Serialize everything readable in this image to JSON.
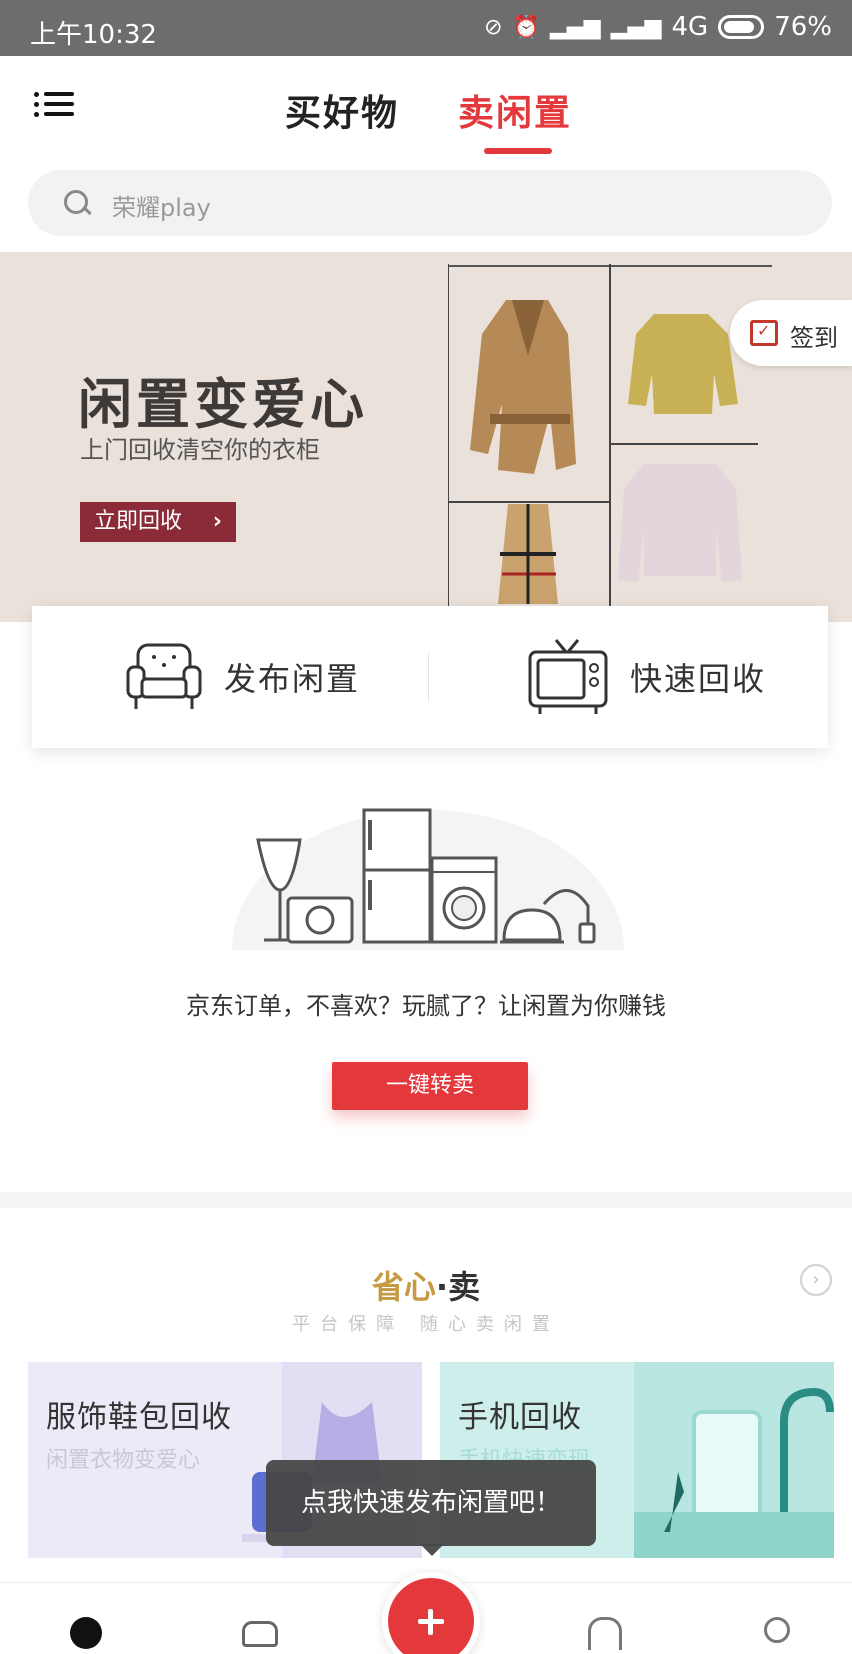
{
  "status_bar": {
    "time": "上午10:32",
    "network": "4G",
    "battery": "76%",
    "icons": [
      "mute-icon",
      "alarm-icon",
      "signal-icon",
      "signal-icon",
      "battery-icon"
    ]
  },
  "header": {
    "tabs": [
      {
        "label": "买好物",
        "active": false
      },
      {
        "label": "卖闲置",
        "active": true
      }
    ],
    "accent_color": "#e4393c"
  },
  "search": {
    "placeholder": "荣耀play"
  },
  "banner": {
    "title": "闲置变爱心",
    "subtitle": "上门回收清空你的衣柜",
    "cta_label": "立即回收",
    "checkin_label": "签到"
  },
  "actions": [
    {
      "label": "发布闲置",
      "icon": "sofa-icon"
    },
    {
      "label": "快速回收",
      "icon": "tv-icon"
    }
  ],
  "promo": {
    "text": "京东订单，不喜欢？玩腻了？让闲置为你赚钱",
    "button_label": "一键转卖"
  },
  "section": {
    "title_highlight": "省心",
    "title_rest": "·卖",
    "subtitle": "平台保障 随心卖闲置"
  },
  "cards": [
    {
      "title": "服饰鞋包回收",
      "subtitle": "闲置衣物变爱心"
    },
    {
      "title": "手机回收",
      "subtitle": "手机快速变现"
    }
  ],
  "toast": {
    "text": "点我快速发布闲置吧！"
  },
  "bottom_nav": {
    "items": [
      "home-icon",
      "cart-icon",
      "publish-icon",
      "message-icon",
      "profile-icon"
    ]
  }
}
